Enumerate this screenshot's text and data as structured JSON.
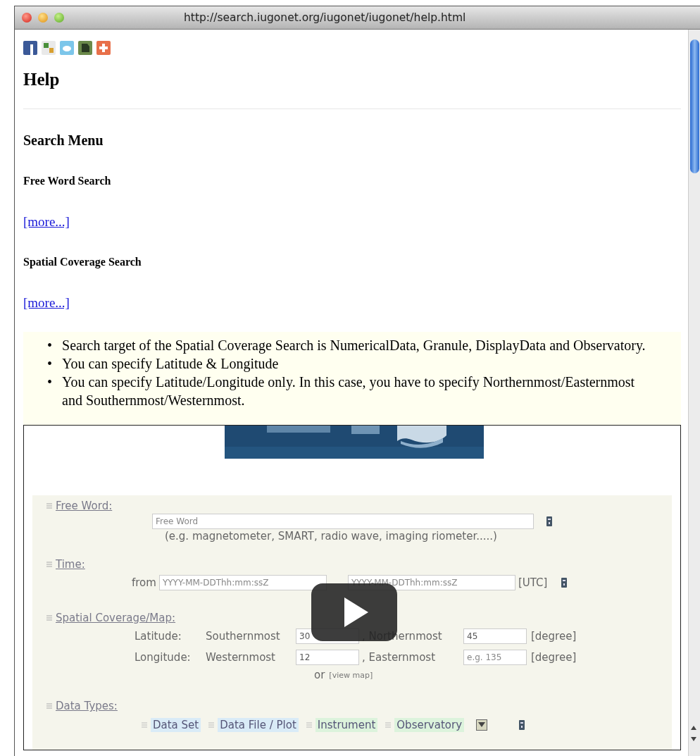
{
  "window": {
    "title": "http://search.iugonet.org/iugonet/iugonet/help.html"
  },
  "heading": "Help",
  "section_title": "Search Menu",
  "subsections": [
    {
      "title": "Free Word Search",
      "link": "[more...]"
    },
    {
      "title": "Spatial Coverage Search",
      "link": "[more...]"
    }
  ],
  "notes": [
    {
      "marker": "•",
      "text": "Search target of the Spatial Coverage Search is NumericalData, Granule, DisplayData and Observatory."
    },
    {
      "marker": "•",
      "text": "You can specify Latitude & Longitude"
    },
    {
      "marker": "•",
      "text": "You can specify Latitude/Longitude only. In this case, you have to specify Northernmost/Easternmost and Southernmost/Westernmost."
    }
  ],
  "video": {
    "free_word": {
      "label": "Free Word:",
      "placeholder": "Free Word",
      "hint": "(e.g. magnetometer, SMART, radio wave, imaging riometer.....)"
    },
    "time": {
      "label": "Time:",
      "from": "from",
      "from_placeholder": "YYYY-MM-DDThh:mm:ssZ",
      "to_placeholder": "YYYY-MM-DDThh:mm:ssZ",
      "unit": "[UTC]"
    },
    "spatial": {
      "label": "Spatial Coverage/Map:",
      "rows": [
        {
          "name": "Latitude:",
          "first": "Southernmost",
          "first_value": "30",
          "second": ", Northernmost",
          "second_value": "45",
          "second_placeholder": "",
          "unit": "[degree]"
        },
        {
          "name": "Longitude:",
          "first": "Westernmost",
          "first_value": "12",
          "second": ", Easternmost",
          "second_value": "",
          "second_placeholder": "e.g. 135",
          "unit": "[degree]"
        }
      ],
      "or": "or",
      "map_link": "[view map]"
    },
    "data_types": {
      "label": "Data Types:",
      "tags": [
        {
          "label": "Data Set",
          "color": "#d9ebf7"
        },
        {
          "label": "Data File / Plot",
          "color": "#d9ebf7"
        },
        {
          "label": "Instrument",
          "color": "#dcf3dc"
        },
        {
          "label": "Observatory",
          "color": "#dcf3dc"
        }
      ]
    }
  }
}
